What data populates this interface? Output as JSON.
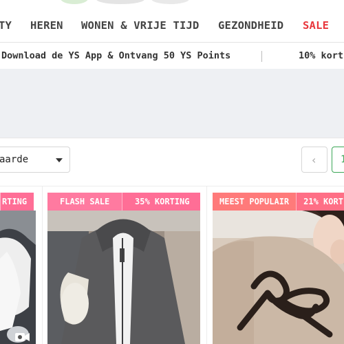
{
  "nav": {
    "items": [
      {
        "label": "TY"
      },
      {
        "label": "HEREN"
      },
      {
        "label": "WONEN & VRIJE TIJD"
      },
      {
        "label": "GEZONDHEID"
      },
      {
        "label": "SALE"
      }
    ],
    "sale_color": "#e8363c"
  },
  "promo": {
    "items": [
      {
        "text": "Download de YS App & Ontvang 50 YS Points"
      },
      {
        "text": "10% kort"
      }
    ]
  },
  "toolbar": {
    "sort_label": "aarde",
    "prev_glyph": "‹",
    "current_page": "1"
  },
  "products": [
    {
      "badges": [
        "RTING"
      ],
      "photo": "woman-white-top-mirror-selfie",
      "video_icon": "video-camera-icon"
    },
    {
      "badges": [
        "FLASH SALE",
        "35% KORTING"
      ],
      "photo": "woman-grey-zip-hoodie"
    },
    {
      "badges": [
        "MEEST POPULAIR",
        "21% KORT"
      ],
      "photo": "woman-beige-bow-sweater"
    }
  ],
  "colors": {
    "accent_green": "#3aa655",
    "badge_pink": "#ff7aa0",
    "badge_coral": "#ff7a7a",
    "banner_bg": "#eef0f3"
  }
}
